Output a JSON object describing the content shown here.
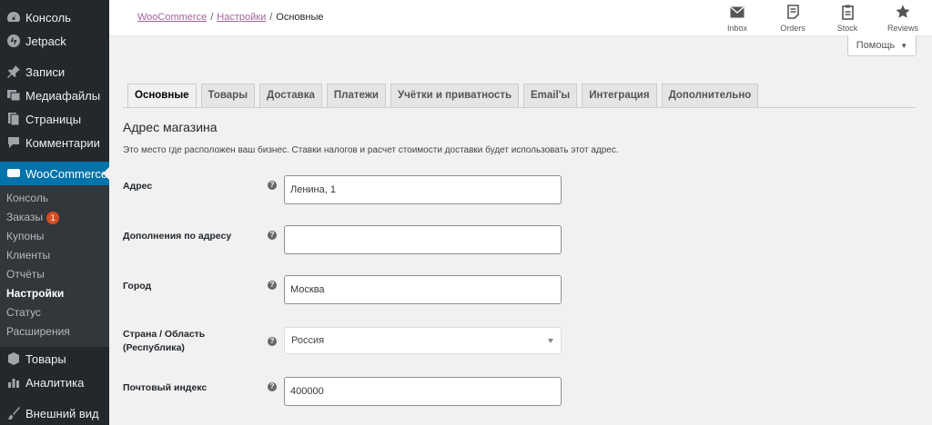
{
  "sidebar": {
    "top_items": [
      {
        "label": "Консоль",
        "icon": "dashboard-icon"
      },
      {
        "label": "Jetpack",
        "icon": "jetpack-icon"
      },
      {
        "label": "Записи",
        "icon": "pin-icon"
      },
      {
        "label": "Медиафайлы",
        "icon": "media-icon"
      },
      {
        "label": "Страницы",
        "icon": "pages-icon"
      },
      {
        "label": "Комментарии",
        "icon": "comments-icon"
      }
    ],
    "woocommerce": {
      "label": "WooCommerce",
      "icon": "woocommerce-icon"
    },
    "submenu": [
      {
        "label": "Консоль"
      },
      {
        "label": "Заказы",
        "badge": "1"
      },
      {
        "label": "Купоны"
      },
      {
        "label": "Клиенты"
      },
      {
        "label": "Отчёты"
      },
      {
        "label": "Настройки",
        "current": true
      },
      {
        "label": "Статус"
      },
      {
        "label": "Расширения"
      }
    ],
    "bottom_items": [
      {
        "label": "Товары",
        "icon": "products-icon"
      },
      {
        "label": "Аналитика",
        "icon": "analytics-icon"
      },
      {
        "label": "Внешний вид",
        "icon": "appearance-icon"
      }
    ]
  },
  "header": {
    "breadcrumb": {
      "woocommerce": "WooCommerce",
      "settings": "Настройки",
      "current": "Основные",
      "separator": "/"
    },
    "actions": [
      {
        "label": "Inbox",
        "icon": "inbox-icon"
      },
      {
        "label": "Orders",
        "icon": "orders-icon"
      },
      {
        "label": "Stock",
        "icon": "stock-icon"
      },
      {
        "label": "Reviews",
        "icon": "star-icon"
      }
    ],
    "help_label": "Помощь"
  },
  "tabs": [
    "Основные",
    "Товары",
    "Доставка",
    "Платежи",
    "Учётки и приватность",
    "Email'ы",
    "Интеграция",
    "Дополнительно"
  ],
  "section": {
    "title": "Адрес магазина",
    "description": "Это место где расположен ваш бизнес. Ставки налогов и расчет стоимости доставки будет использовать этот адрес."
  },
  "fields": {
    "address": {
      "label": "Адрес",
      "value": "Ленина, 1"
    },
    "address2": {
      "label": "Дополнения по адресу",
      "value": ""
    },
    "city": {
      "label": "Город",
      "value": "Москва"
    },
    "country": {
      "label": "Страна / Область (Республика)",
      "value": "Россия"
    },
    "postcode": {
      "label": "Почтовый индекс",
      "value": "400000"
    }
  },
  "help_tip_symbol": "?",
  "colors": {
    "sidebar_bg": "#23282d",
    "active": "#0073aa",
    "link": "#a46497",
    "badge": "#d54e21"
  }
}
